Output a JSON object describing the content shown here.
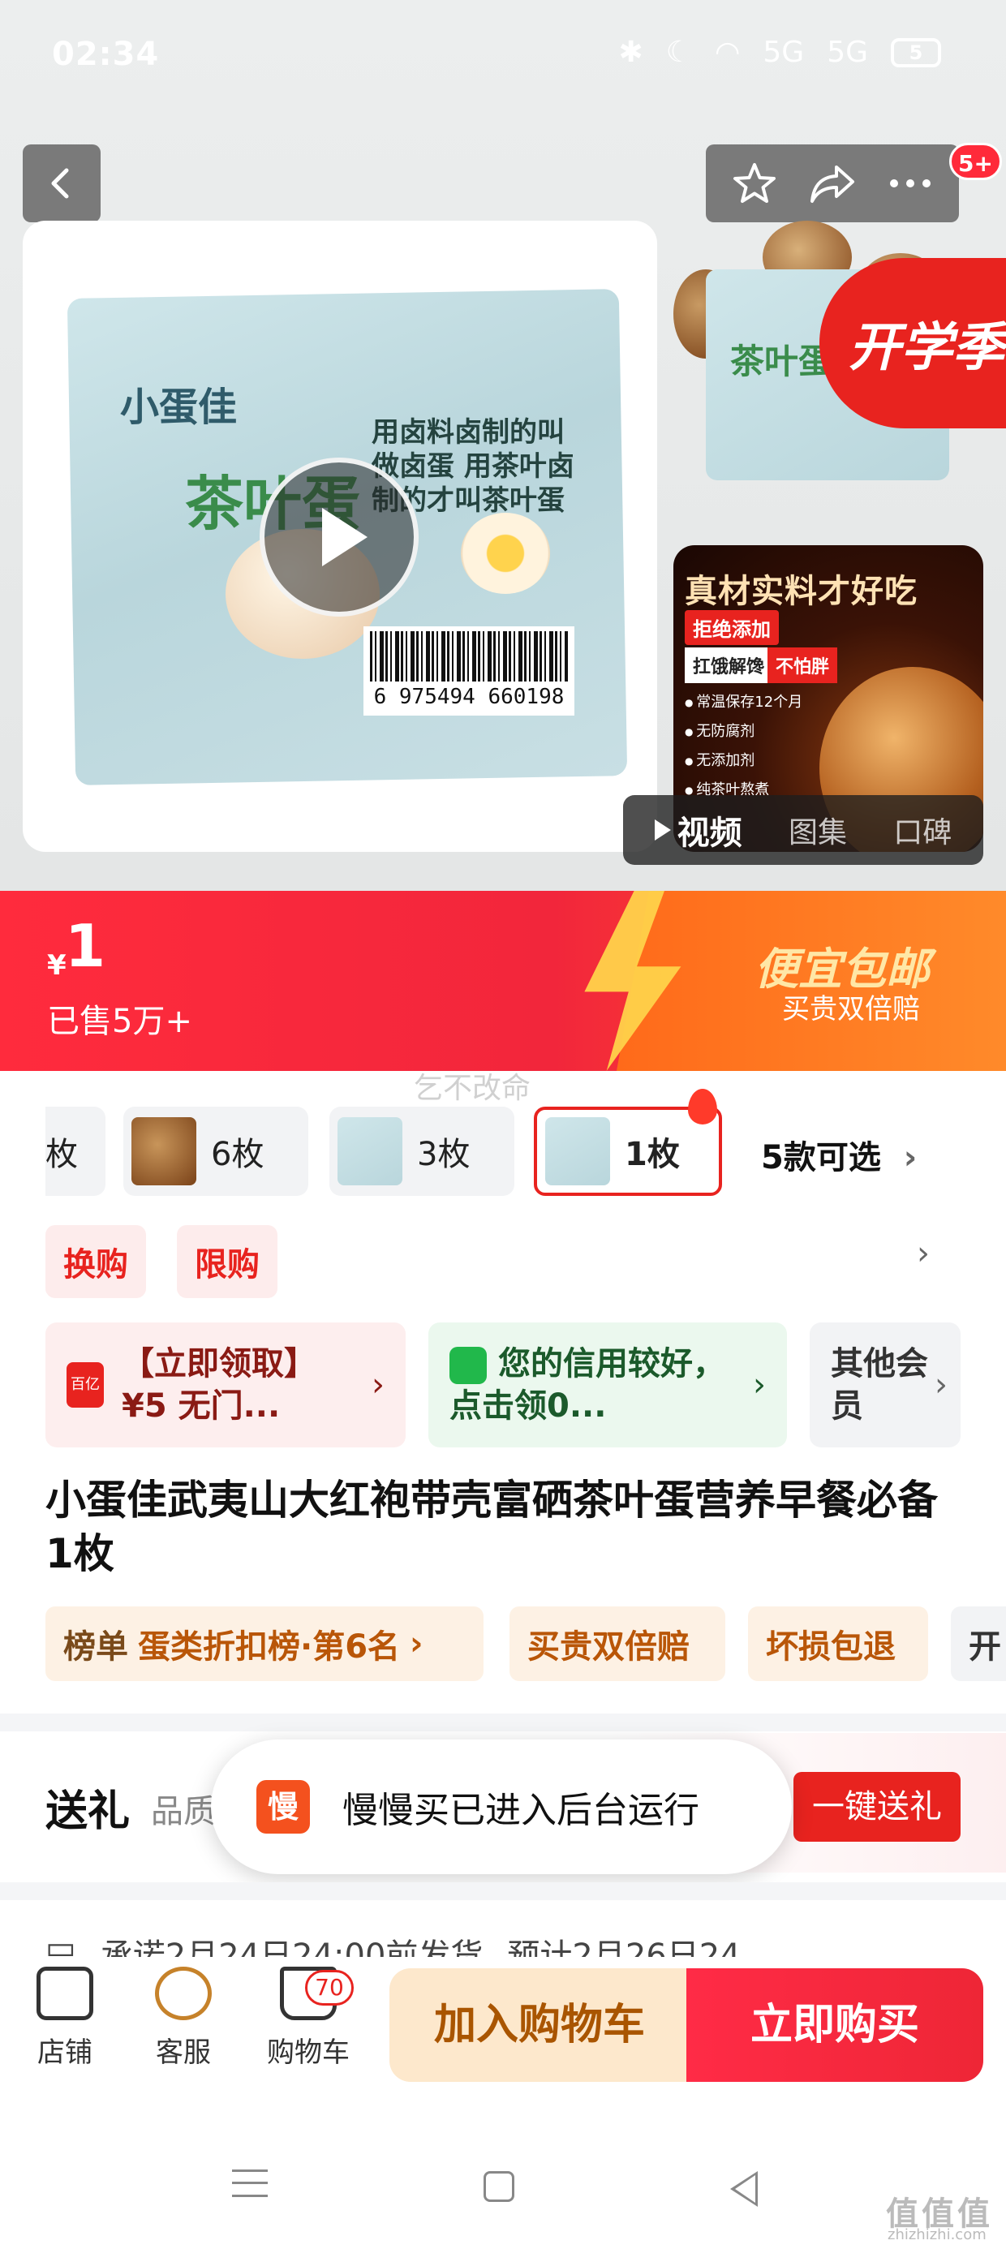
{
  "status_bar": {
    "time": "02:34",
    "battery": "5",
    "network": "5G"
  },
  "header": {
    "message_badge": "5+"
  },
  "gallery": {
    "package_brand": "小蛋佳",
    "package_name": "茶叶蛋",
    "package_slogan": "用卤料卤制的叫做卤蛋 用茶叶卤制的才叫茶叶蛋",
    "barcode_number": "6 975494 660198",
    "season_badge": "开学季",
    "ad": {
      "title": "真材实料才好吃",
      "tag": "拒绝添加",
      "chip_a": "扛饿解馋",
      "chip_b": "不怕胖",
      "bullets": [
        "常温保存12个月",
        "无防腐剂",
        "无添加剂",
        "纯茶叶熬煮"
      ]
    },
    "media_tabs": [
      {
        "label": "视频",
        "active": true
      },
      {
        "label": "图集",
        "active": false
      },
      {
        "label": "口碑",
        "active": false
      }
    ]
  },
  "price": {
    "currency": "¥",
    "amount": "1",
    "sold": "已售5万+",
    "promo_title": "便宜包邮",
    "promo_sub": "买贵双倍赔"
  },
  "watermark": "乞不改命",
  "variants": {
    "items": [
      {
        "label": "枚"
      },
      {
        "label": "6枚"
      },
      {
        "label": "3枚"
      },
      {
        "label": "1枚"
      }
    ],
    "more": "5款可选"
  },
  "tags": [
    "换购",
    "限购"
  ],
  "coupons": {
    "red": {
      "icon": "百亿",
      "text": "【立即领取】¥5 无门..."
    },
    "green": {
      "text": "您的信用较好，点击领0..."
    },
    "gray": {
      "text": "其他会员"
    }
  },
  "product_title": "小蛋佳武夷山大红袍带壳富硒茶叶蛋营养早餐必备 1枚",
  "info_chips": {
    "rank_label": "榜单",
    "rank_value": "蛋类折扣榜·第6名",
    "chip2": "买贵双倍赔",
    "chip3": "坏损包退",
    "chip4": "开"
  },
  "gift": {
    "title": "送礼",
    "sub": "品质",
    "button": "一键送礼"
  },
  "toast": {
    "icon": "慢",
    "text": "慢慢买已进入后台运行"
  },
  "shipping": {
    "promise": "承诺2月24日24:00前发货",
    "eta": "预计2月26日24"
  },
  "bottom_nav": {
    "store": "店铺",
    "service": "客服",
    "cart": "购物车",
    "cart_count": "70"
  },
  "actions": {
    "add_to_cart": "加入购物车",
    "buy_now": "立即购买"
  },
  "corner": {
    "mark": "值值值",
    "site": "zhizhizhi.com"
  },
  "colors": {
    "accent": "#e8231f",
    "promo_gold": "#ffe7a6",
    "cart_bg": "#fde8cc"
  }
}
